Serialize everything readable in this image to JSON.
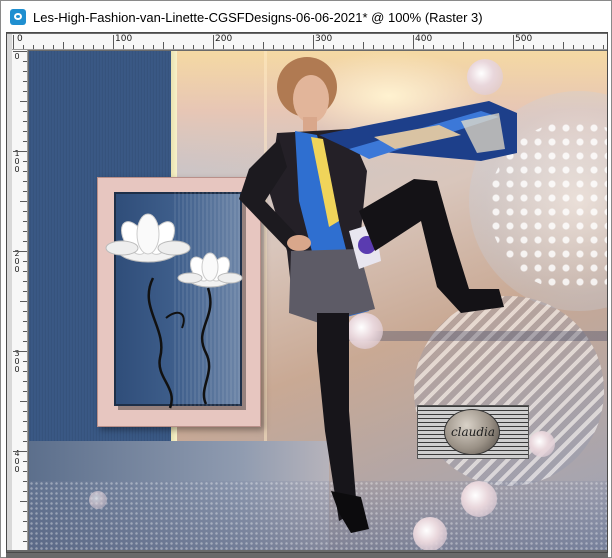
{
  "window": {
    "title": "Les-High-Fashion-van-Linette-CGSFDesigns-06-06-2021* @ 100% (Raster 3)",
    "icon": "paintshop-app-icon"
  },
  "ruler_top": {
    "labels": [
      "0",
      "100",
      "200",
      "300",
      "400",
      "500"
    ]
  },
  "ruler_left": {
    "labels": [
      [
        "0"
      ],
      [
        "1",
        "0",
        "0"
      ],
      [
        "2",
        "0",
        "0"
      ],
      [
        "3",
        "0",
        "0"
      ],
      [
        "4",
        "0",
        "0"
      ]
    ]
  },
  "canvas": {
    "watermark_text": "claudia",
    "colors": {
      "blue_stripe": "#3b5b86",
      "frame_pink": "#e7c6c0",
      "scarf_blue": "#2f6fd0"
    }
  }
}
